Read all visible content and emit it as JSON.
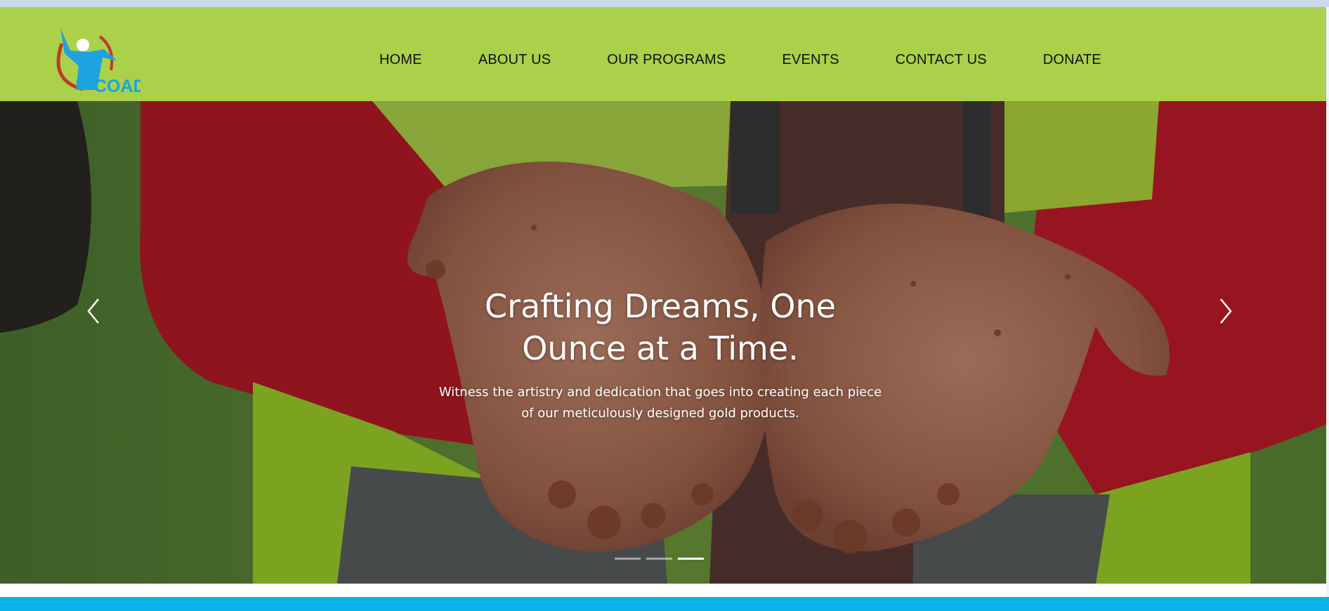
{
  "brand": {
    "logo_text": "COAD",
    "colors": {
      "header_green": "#abd04a",
      "logo_blue": "#1ca3e0",
      "logo_red": "#c0392b",
      "footer_blue": "#0cb2ea"
    }
  },
  "nav": {
    "items": [
      {
        "label": "HOME"
      },
      {
        "label": "ABOUT US"
      },
      {
        "label": "OUR PROGRAMS"
      },
      {
        "label": "EVENTS"
      },
      {
        "label": "CONTACT US"
      },
      {
        "label": "DONATE"
      }
    ]
  },
  "hero": {
    "title_lines": [
      "Crafting Dreams, One",
      "Ounce at a Time."
    ],
    "subtitle_lines": [
      "Witness the artistry and dedication that goes into creating each piece",
      "of our meticulously designed gold products."
    ],
    "prev_icon": "chevron-left-icon",
    "next_icon": "chevron-right-icon",
    "slide_count": 3,
    "active_slide": 3
  }
}
